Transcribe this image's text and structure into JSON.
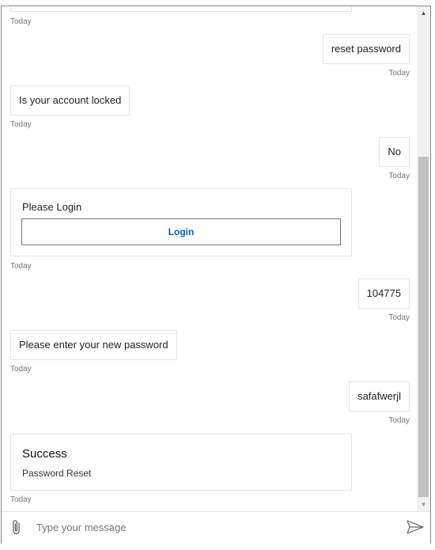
{
  "messages": [
    {
      "side": "bot",
      "kind": "partial-card",
      "timestamp": "Today"
    },
    {
      "side": "user",
      "kind": "text",
      "text": "reset password",
      "timestamp": "Today"
    },
    {
      "side": "bot",
      "kind": "text",
      "text": "Is your account locked",
      "timestamp": "Today"
    },
    {
      "side": "user",
      "kind": "text",
      "text": "No",
      "timestamp": "Today"
    },
    {
      "side": "bot",
      "kind": "login-card",
      "title": "Please Login",
      "button_label": "Login",
      "timestamp": "Today"
    },
    {
      "side": "user",
      "kind": "text",
      "text": "104775",
      "timestamp": "Today"
    },
    {
      "side": "bot",
      "kind": "text",
      "text": "Please enter your new password",
      "timestamp": "Today"
    },
    {
      "side": "user",
      "kind": "text",
      "text": "safafwerjl",
      "timestamp": "Today"
    },
    {
      "side": "bot",
      "kind": "status-card",
      "title": "Success",
      "subtitle": "Password Reset",
      "timestamp": "Today"
    }
  ],
  "input": {
    "placeholder": "Type your message",
    "value": "",
    "attach_icon": "paperclip-icon",
    "send_icon": "send-icon"
  },
  "scrollbar": {
    "up_icon": "scroll-up-icon",
    "down_icon": "scroll-down-icon",
    "position": "bottom"
  },
  "colors": {
    "accent": "#0063b1",
    "timestamp": "#767676",
    "bubble_border": "#e5e5e5"
  }
}
